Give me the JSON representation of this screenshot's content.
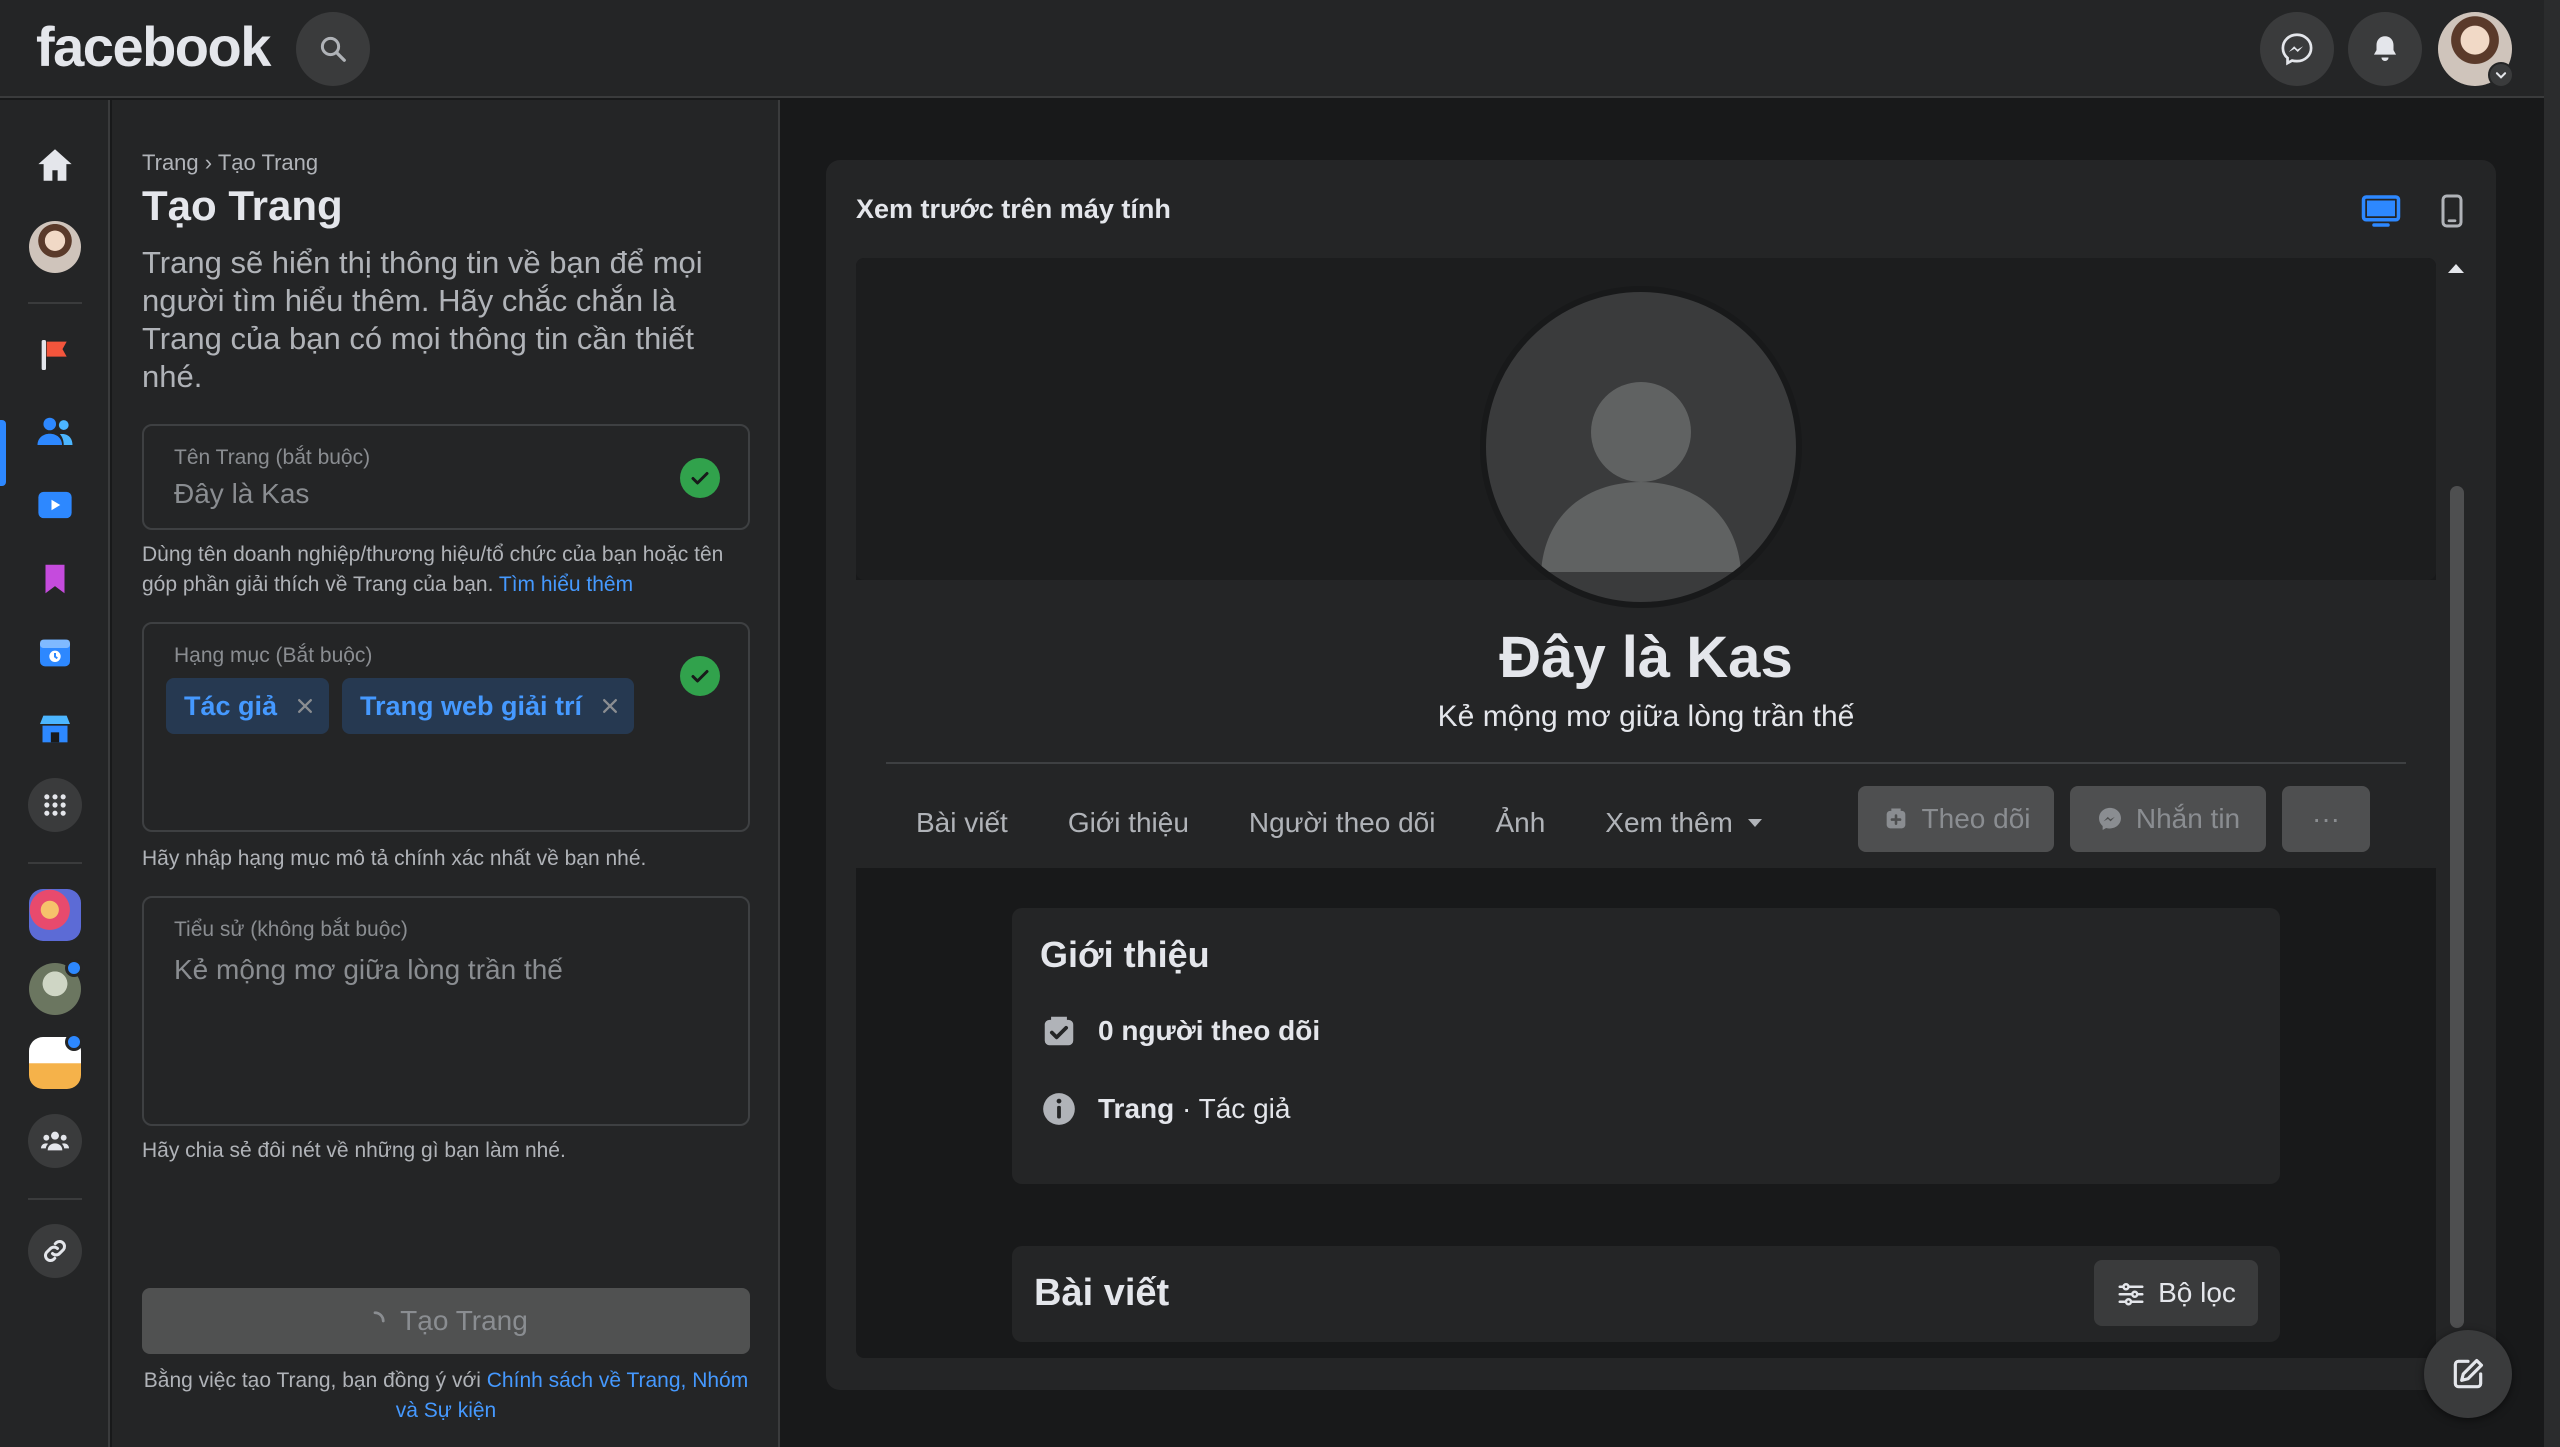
{
  "app": {
    "logo_text": "facebook"
  },
  "colors": {
    "accent": "#2d88ff",
    "link": "#4599ff",
    "success": "#31a24c",
    "background": "#18191a",
    "surface": "#242526"
  },
  "topbar": {
    "icons": [
      "search-icon",
      "messenger-icon",
      "bell-icon",
      "profile-avatar",
      "chevron-down-icon"
    ]
  },
  "rail": {
    "icons": [
      "home-icon",
      "profile-avatar",
      "flag-icon",
      "friends-icon",
      "watch-icon",
      "bookmark-icon",
      "memories-icon",
      "marketplace-icon",
      "apps-grid-icon",
      "shortcut-avatar",
      "shortcut-avatar",
      "shortcut-avatar",
      "groups-icon",
      "link-icon"
    ]
  },
  "form": {
    "breadcrumb_root": "Trang",
    "breadcrumb_sep": "›",
    "breadcrumb_current": "Tạo Trang",
    "title": "Tạo Trang",
    "intro": "Trang sẽ hiển thị thông tin về bạn để mọi người tìm hiểu thêm. Hãy chắc chắn là Trang của bạn có mọi thông tin cần thiết nhé.",
    "name_label": "Tên Trang (bắt buộc)",
    "name_value": "Đây là Kas",
    "name_help": "Dùng tên doanh nghiệp/thương hiệu/tổ chức của bạn hoặc tên góp phần giải thích về Trang của bạn.",
    "name_help_link": "Tìm hiểu thêm",
    "category_label": "Hạng mục (Bắt buộc)",
    "categories": [
      "Tác giả",
      "Trang web giải trí"
    ],
    "category_help": "Hãy nhập hạng mục mô tả chính xác nhất về bạn nhé.",
    "bio_label": "Tiểu sử (không bắt buộc)",
    "bio_value": "Kẻ mộng mơ giữa lòng trần thế",
    "bio_help": "Hãy chia sẻ đôi nét về những gì bạn làm nhé.",
    "create_button": "Tạo Trang",
    "terms_prefix": "Bằng việc tạo Trang, bạn đồng ý với",
    "terms_link": "Chính sách về Trang, Nhóm và Sự kiện"
  },
  "preview": {
    "title": "Xem trước trên máy tính",
    "page_name": "Đây là Kas",
    "page_bio": "Kẻ mộng mơ giữa lòng trần thế",
    "tabs": [
      "Bài viết",
      "Giới thiệu",
      "Người theo dõi",
      "Ảnh",
      "Xem thêm"
    ],
    "follow_button": "Theo dõi",
    "message_button": "Nhắn tin",
    "more_button": "···",
    "about_title": "Giới thiệu",
    "followers_text": "0 người theo dõi",
    "page_type_strong": "Trang",
    "page_type_rest": " · Tác giả",
    "posts_title": "Bài viết",
    "filter_button": "Bộ lọc"
  }
}
